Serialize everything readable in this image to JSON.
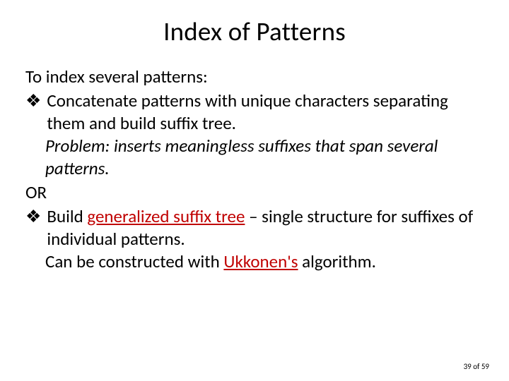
{
  "title": "Index of Patterns",
  "intro": "To index several patterns:",
  "bullet1": {
    "mark": "❖",
    "text": "Concatenate patterns with unique characters separating them and build suffix tree.",
    "problem_label": "Problem:",
    "problem_rest": " inserts meaningless suffixes that span several patterns."
  },
  "or": "OR",
  "bullet2": {
    "mark": "❖",
    "pre": "Build ",
    "gst": "generalized suffix tree",
    "post": " – single structure for suffixes of individual patterns.",
    "line2a": "Can be constructed with ",
    "ukk": "Ukkonen's",
    "line2b": " algorithm."
  },
  "footer": "39 of 59"
}
